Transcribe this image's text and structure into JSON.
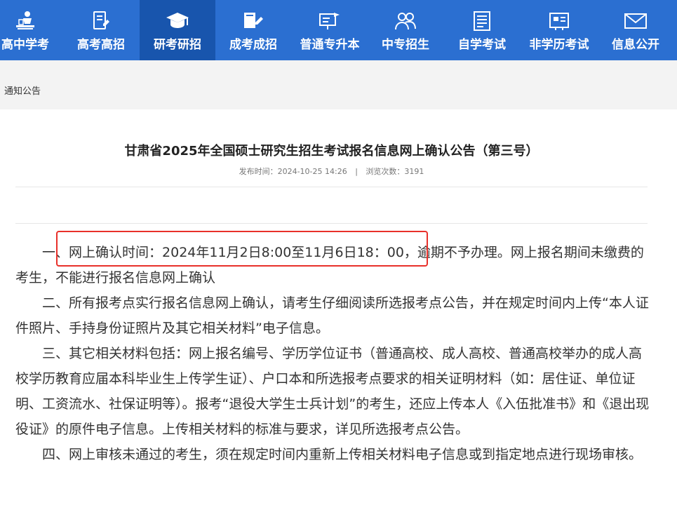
{
  "nav": {
    "items": [
      {
        "label": "高中学考",
        "icon": "student-desk-icon",
        "active": false
      },
      {
        "label": "高考高招",
        "icon": "pencil-paper-icon",
        "active": false
      },
      {
        "label": "研考研招",
        "icon": "graduation-cap-icon",
        "active": true
      },
      {
        "label": "成考成招",
        "icon": "book-pen-icon",
        "active": false
      },
      {
        "label": "普通专升本",
        "icon": "presentation-board-icon",
        "active": false
      },
      {
        "label": "中专招生",
        "icon": "people-icon",
        "active": false
      },
      {
        "label": "自学考试",
        "icon": "document-list-icon",
        "active": false
      },
      {
        "label": "非学历考试",
        "icon": "certificate-icon",
        "active": false
      },
      {
        "label": "信息公开",
        "icon": "envelope-icon",
        "active": false
      }
    ],
    "colors": {
      "bar": "#2b6fd1",
      "active": "#1855ad"
    }
  },
  "breadcrumb": "通知公告",
  "article": {
    "title": "甘肃省2025年全国硕士研究生招生考试报名信息网上确认公告（第三号）",
    "publish_label": "发布时间：",
    "publish_time": "2024-10-25 14:26",
    "meta_separator": "|",
    "views_label": "浏览次数：",
    "views": "3191",
    "paragraphs": [
      {
        "prefix": "一、",
        "highlight": "网上确认时间：2024年11月2日8:00至11月6日18：00",
        "rest": "，逾期不予办理。网上报名期间未缴费的考生，不能进行报名信息网上确认"
      },
      {
        "text": "二、所有报考点实行报名信息网上确认，请考生仔细阅读所选报考点公告，并在规定时间内上传“本人证件照片、手持身份证照片及其它相关材料”电子信息。"
      },
      {
        "text": "三、其它相关材料包括：网上报名编号、学历学位证书（普通高校、成人高校、普通高校举办的成人高校学历教育应届本科毕业生上传学生证）、户口本和所选报考点要求的相关证明材料（如：居住证、单位证明、工资流水、社保证明等）。报考“退役大学生士兵计划”的考生，还应上传本人《入伍批准书》和《退出现役证》的原件电子信息。上传相关材料的标准与要求，详见所选报考点公告。"
      },
      {
        "text": "四、网上审核未通过的考生，须在规定时间内重新上传相关材料电子信息或到指定地点进行现场审核。"
      }
    ],
    "highlight_color": "#e8302a"
  }
}
